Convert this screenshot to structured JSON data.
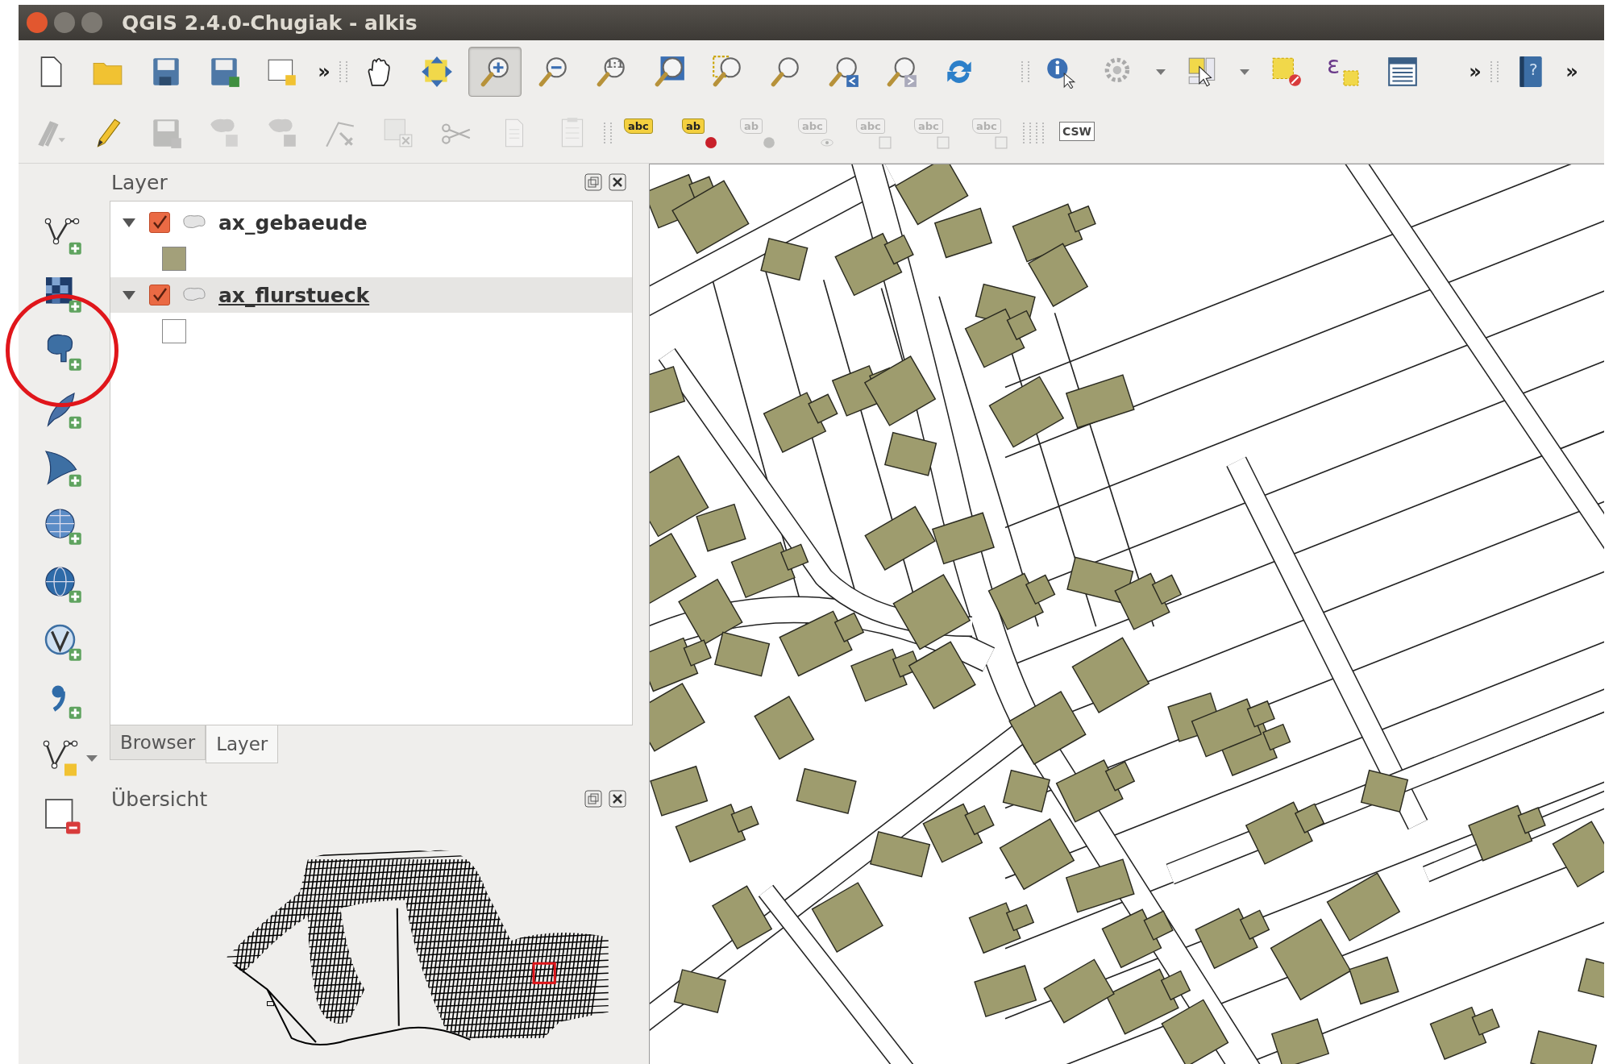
{
  "window": {
    "title": "QGIS 2.4.0-Chugiak - alkis"
  },
  "toolbar_1": [
    {
      "kind": "blank-page",
      "selected": false
    },
    {
      "kind": "folder",
      "selected": false
    },
    {
      "kind": "floppy-disk",
      "selected": false
    },
    {
      "kind": "floppy-pencil",
      "selected": false
    },
    {
      "kind": "page-plus",
      "selected": false
    },
    {
      "kind": "chevron",
      "text": "»",
      "selected": false
    },
    {
      "kind": "grip"
    },
    {
      "kind": "hand",
      "selected": false
    },
    {
      "kind": "arrows-cross",
      "selected": false
    },
    {
      "kind": "magnifier-plus",
      "selected": true
    },
    {
      "kind": "magnifier-minus",
      "selected": false
    },
    {
      "kind": "magnifier-text",
      "text": "1:1",
      "selected": false
    },
    {
      "kind": "magnifier-arrows",
      "selected": false
    },
    {
      "kind": "magnifier-square",
      "selected": false
    },
    {
      "kind": "magnifier",
      "selected": false
    },
    {
      "kind": "magnifier-back",
      "selected": false
    },
    {
      "kind": "magnifier-forward",
      "selected": false
    },
    {
      "kind": "refresh",
      "selected": false
    },
    {
      "kind": "spacer"
    },
    {
      "kind": "grip"
    },
    {
      "kind": "info-cursor",
      "selected": false
    },
    {
      "kind": "gear-cursor",
      "selected": false
    },
    {
      "kind": "dropdown",
      "selected": false
    },
    {
      "kind": "select-cursor",
      "selected": false
    },
    {
      "kind": "dropdown",
      "selected": false
    },
    {
      "kind": "square-no",
      "selected": false
    },
    {
      "kind": "epsilon-square",
      "text": "ε",
      "selected": false
    },
    {
      "kind": "table",
      "selected": false
    },
    {
      "kind": "spacer"
    },
    {
      "kind": "chevron",
      "text": "»",
      "selected": false
    },
    {
      "kind": "grip"
    },
    {
      "kind": "help-book",
      "text": "?",
      "selected": false
    },
    {
      "kind": "chevron",
      "text": "»",
      "selected": false
    }
  ],
  "toolbar_2": [
    {
      "kind": "pencils-dropdown",
      "disabled": true
    },
    {
      "kind": "pencil",
      "disabled": false
    },
    {
      "kind": "floppy-pencil",
      "disabled": true
    },
    {
      "kind": "blob-star",
      "disabled": true
    },
    {
      "kind": "blob-arrow",
      "disabled": true
    },
    {
      "kind": "node-tool",
      "disabled": true
    },
    {
      "kind": "square-x",
      "disabled": true
    },
    {
      "kind": "scissors",
      "disabled": true
    },
    {
      "kind": "copy-page",
      "disabled": true
    },
    {
      "kind": "clipboard",
      "disabled": true
    },
    {
      "kind": "grip"
    },
    {
      "kind": "label-tag",
      "text": "abc",
      "disabled": false
    },
    {
      "kind": "label-dot",
      "text": "ab",
      "disabled": false
    },
    {
      "kind": "label-pin",
      "text": "ab",
      "disabled": true
    },
    {
      "kind": "label-eye",
      "text": "abc",
      "disabled": true
    },
    {
      "kind": "label-move",
      "text": "abc",
      "disabled": true
    },
    {
      "kind": "label-rotate",
      "text": "abc",
      "disabled": true
    },
    {
      "kind": "label-edit",
      "text": "abc",
      "disabled": true
    },
    {
      "kind": "grip"
    },
    {
      "kind": "grip"
    },
    {
      "kind": "csw",
      "text": "CSW",
      "disabled": false
    }
  ],
  "layer_panel": {
    "title": "Layer",
    "layers": [
      {
        "name": "ax_gebaeude",
        "expanded": true,
        "checked": true,
        "selected": false,
        "children": [
          {
            "color": "#a3a07a"
          }
        ]
      },
      {
        "name": "ax_flurstueck",
        "expanded": true,
        "checked": true,
        "selected": true,
        "children": [
          {
            "color": "#ffffff"
          }
        ]
      }
    ]
  },
  "tabs": [
    {
      "label": "Browser",
      "selected": false
    },
    {
      "label": "Layer",
      "selected": true
    }
  ],
  "overview_panel": {
    "title": "Übersicht"
  }
}
